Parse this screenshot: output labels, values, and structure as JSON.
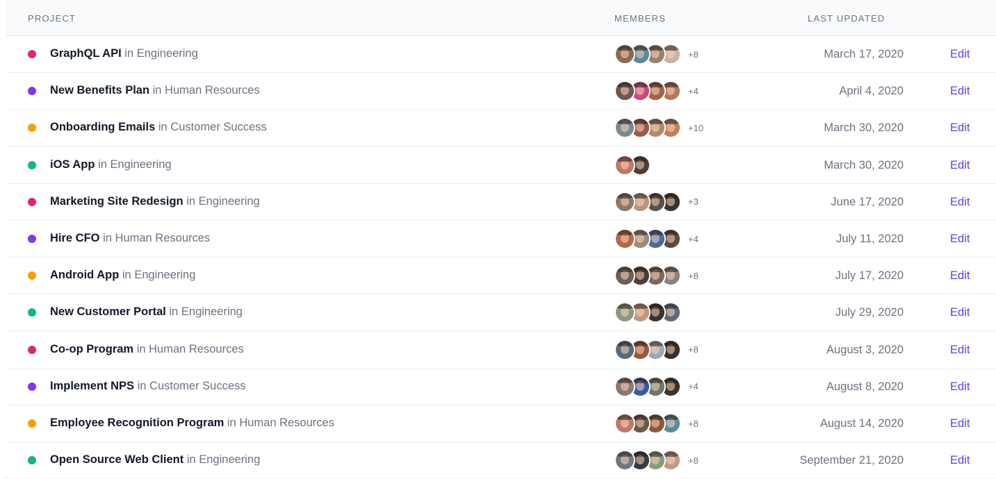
{
  "header": {
    "project": "PROJECT",
    "members": "MEMBERS",
    "last_updated": "LAST UPDATED"
  },
  "colors": {
    "pink": "#db2777",
    "purple": "#7c3aed",
    "yellow": "#f59e0b",
    "green": "#10b981",
    "edit_link": "#4f46e5"
  },
  "rows": [
    {
      "name": "GraphQL API",
      "in_text": "in Engineering",
      "dot_color": "#db2777",
      "avatars": [
        "#8a6a55",
        "#5a8a9a",
        "#9a8070",
        "#c9b3a2"
      ],
      "more": "+8",
      "date": "March 17, 2020",
      "edit": "Edit"
    },
    {
      "name": "New Benefits Plan",
      "in_text": "in Human Resources",
      "dot_color": "#7c3aed",
      "avatars": [
        "#6b5a4e",
        "#c94b7e",
        "#a0654a",
        "#b07a5a"
      ],
      "more": "+4",
      "date": "April 4, 2020",
      "edit": "Edit"
    },
    {
      "name": "Onboarding Emails",
      "in_text": "in Customer Success",
      "dot_color": "#f59e0b",
      "avatars": [
        "#7a8a90",
        "#9a5a4a",
        "#b08a70",
        "#c08060"
      ],
      "more": "+10",
      "date": "March 30, 2020",
      "edit": "Edit"
    },
    {
      "name": "iOS App",
      "in_text": "in Engineering",
      "dot_color": "#10b981",
      "avatars": [
        "#c07a6a",
        "#4a4038"
      ],
      "more": "",
      "date": "March 30, 2020",
      "edit": "Edit"
    },
    {
      "name": "Marketing Site Redesign",
      "in_text": "in Engineering",
      "dot_color": "#db2777",
      "avatars": [
        "#8a7a6a",
        "#b8957a",
        "#5a5048",
        "#3a3430"
      ],
      "more": "+3",
      "date": "June 17, 2020",
      "edit": "Edit"
    },
    {
      "name": "Hire CFO",
      "in_text": "in Human Resources",
      "dot_color": "#7c3aed",
      "avatars": [
        "#b06a4a",
        "#9a8a80",
        "#4a6aa0",
        "#5a4a40"
      ],
      "more": "+4",
      "date": "July 11, 2020",
      "edit": "Edit"
    },
    {
      "name": "Android App",
      "in_text": "in Engineering",
      "dot_color": "#f59e0b",
      "avatars": [
        "#6a6058",
        "#4a4038",
        "#7a6a5a",
        "#8a8480"
      ],
      "more": "+8",
      "date": "July 17, 2020",
      "edit": "Edit"
    },
    {
      "name": "New Customer Portal",
      "in_text": "in Engineering",
      "dot_color": "#10b981",
      "avatars": [
        "#8a9a80",
        "#c09a80",
        "#3a3430",
        "#5a6a7a"
      ],
      "more": "",
      "date": "July 29, 2020",
      "edit": "Edit"
    },
    {
      "name": "Co-op Program",
      "in_text": "in Human Resources",
      "dot_color": "#db2777",
      "avatars": [
        "#5a6a7a",
        "#9a5a3a",
        "#a0a8b0",
        "#3a302a"
      ],
      "more": "+8",
      "date": "August 3, 2020",
      "edit": "Edit"
    },
    {
      "name": "Implement NPS",
      "in_text": "in Customer Success",
      "dot_color": "#7c3aed",
      "avatars": [
        "#8a7a70",
        "#3a5aa0",
        "#6a7a6a",
        "#3a3430"
      ],
      "more": "+4",
      "date": "August 8, 2020",
      "edit": "Edit"
    },
    {
      "name": "Employee Recognition Program",
      "in_text": "in Human Resources",
      "dot_color": "#f59e0b",
      "avatars": [
        "#c07a6a",
        "#6a5a4a",
        "#8a5a3a",
        "#5a8aa0"
      ],
      "more": "+8",
      "date": "August 14, 2020",
      "edit": "Edit"
    },
    {
      "name": "Open Source Web Client",
      "in_text": "in Engineering",
      "dot_color": "#10b981",
      "avatars": [
        "#6a7a80",
        "#3a3a40",
        "#8a9a80",
        "#c09a8a"
      ],
      "more": "+8",
      "date": "September 21, 2020",
      "edit": "Edit"
    }
  ]
}
